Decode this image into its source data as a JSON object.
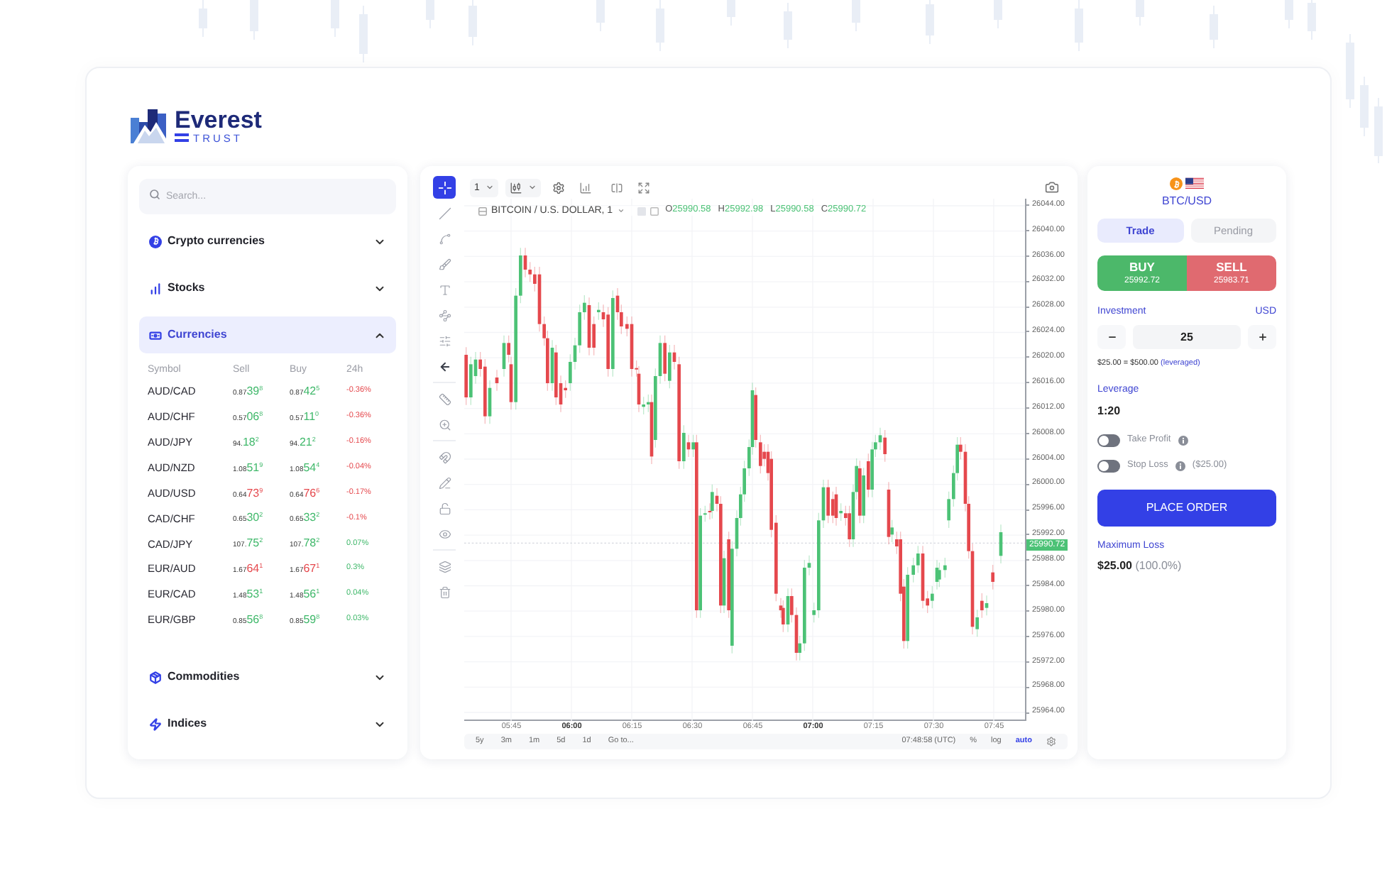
{
  "brand": {
    "name": "Everest",
    "tagline": "TRUST"
  },
  "sidebar": {
    "search_placeholder": "Search...",
    "sections": [
      {
        "kind": "crypto",
        "title": "Crypto currencies",
        "expanded": false
      },
      {
        "kind": "stocks",
        "title": "Stocks",
        "expanded": false
      },
      {
        "kind": "currencies",
        "title": "Currencies",
        "expanded": true,
        "table": {
          "columns": [
            "Symbol",
            "Sell",
            "Buy",
            "24h"
          ],
          "rows": [
            {
              "symbol": "AUD/CAD",
              "sell": {
                "lead": "0.87",
                "pips": "39",
                "last": "8",
                "up": true
              },
              "buy": {
                "lead": "0.87",
                "pips": "42",
                "last": "5",
                "up": true
              },
              "change": {
                "text": "-0.36%",
                "up": false
              }
            },
            {
              "symbol": "AUD/CHF",
              "sell": {
                "lead": "0.57",
                "pips": "06",
                "last": "8",
                "up": true
              },
              "buy": {
                "lead": "0.57",
                "pips": "11",
                "last": "0",
                "up": true
              },
              "change": {
                "text": "-0.36%",
                "up": false
              }
            },
            {
              "symbol": "AUD/JPY",
              "sell": {
                "lead": "94.",
                "pips": "18",
                "last": "2",
                "up": true
              },
              "buy": {
                "lead": "94.",
                "pips": "21",
                "last": "2",
                "up": true
              },
              "change": {
                "text": "-0.16%",
                "up": false
              }
            },
            {
              "symbol": "AUD/NZD",
              "sell": {
                "lead": "1.08",
                "pips": "51",
                "last": "9",
                "up": true
              },
              "buy": {
                "lead": "1.08",
                "pips": "54",
                "last": "4",
                "up": true
              },
              "change": {
                "text": "-0.04%",
                "up": false
              }
            },
            {
              "symbol": "AUD/USD",
              "sell": {
                "lead": "0.64",
                "pips": "73",
                "last": "9",
                "up": false
              },
              "buy": {
                "lead": "0.64",
                "pips": "76",
                "last": "6",
                "up": false
              },
              "change": {
                "text": "-0.17%",
                "up": false
              }
            },
            {
              "symbol": "CAD/CHF",
              "sell": {
                "lead": "0.65",
                "pips": "30",
                "last": "2",
                "up": true
              },
              "buy": {
                "lead": "0.65",
                "pips": "33",
                "last": "2",
                "up": true
              },
              "change": {
                "text": "-0.1%",
                "up": false
              }
            },
            {
              "symbol": "CAD/JPY",
              "sell": {
                "lead": "107.",
                "pips": "75",
                "last": "2",
                "up": true
              },
              "buy": {
                "lead": "107.",
                "pips": "78",
                "last": "2",
                "up": true
              },
              "change": {
                "text": "0.07%",
                "up": true
              }
            },
            {
              "symbol": "EUR/AUD",
              "sell": {
                "lead": "1.67",
                "pips": "64",
                "last": "1",
                "up": false
              },
              "buy": {
                "lead": "1.67",
                "pips": "67",
                "last": "1",
                "up": false
              },
              "change": {
                "text": "0.3%",
                "up": true
              }
            },
            {
              "symbol": "EUR/CAD",
              "sell": {
                "lead": "1.48",
                "pips": "53",
                "last": "1",
                "up": true
              },
              "buy": {
                "lead": "1.48",
                "pips": "56",
                "last": "1",
                "up": true
              },
              "change": {
                "text": "0.04%",
                "up": true
              }
            },
            {
              "symbol": "EUR/GBP",
              "sell": {
                "lead": "0.85",
                "pips": "56",
                "last": "8",
                "up": true
              },
              "buy": {
                "lead": "0.85",
                "pips": "59",
                "last": "8",
                "up": true
              },
              "change": {
                "text": "0.03%",
                "up": true
              }
            }
          ]
        }
      },
      {
        "kind": "commodities",
        "title": "Commodities",
        "expanded": false
      },
      {
        "kind": "indices",
        "title": "Indices",
        "expanded": false
      }
    ]
  },
  "chart": {
    "tool_groups": [
      [
        {
          "kind": "crosshair",
          "selected": true
        },
        {
          "kind": "line",
          "selected": false
        },
        {
          "kind": "fib",
          "selected": false
        },
        {
          "kind": "brush",
          "selected": false
        },
        {
          "kind": "text",
          "selected": false
        },
        {
          "kind": "pattern",
          "selected": false
        },
        {
          "kind": "forecast",
          "selected": false
        },
        {
          "kind": "back",
          "selected": false
        }
      ],
      [
        {
          "kind": "measure",
          "selected": false
        },
        {
          "kind": "zoom",
          "selected": false
        }
      ],
      [
        {
          "kind": "magnet",
          "selected": false
        },
        {
          "kind": "draw_lock",
          "selected": false
        },
        {
          "kind": "lock",
          "selected": false
        },
        {
          "kind": "visibility",
          "selected": false
        }
      ],
      [
        {
          "kind": "layers",
          "selected": false
        },
        {
          "kind": "trash",
          "selected": false
        }
      ]
    ],
    "interval": "1",
    "legend": {
      "title": "BITCOIN / U.S. DOLLAR, 1",
      "values": [
        {
          "label": "O",
          "value": "25990.58"
        },
        {
          "label": "H",
          "value": "25992.98"
        },
        {
          "label": "L",
          "value": "25990.58"
        },
        {
          "label": "C",
          "value": "25990.72"
        }
      ]
    },
    "price_axis": [
      "26044.00",
      "26040.00",
      "26036.00",
      "26032.00",
      "26028.00",
      "26024.00",
      "26020.00",
      "26016.00",
      "26012.00",
      "26008.00",
      "26004.00",
      "26000.00",
      "25996.00",
      "25992.00",
      "25988.00",
      "25984.00",
      "25980.00",
      "25976.00",
      "25972.00",
      "25968.00",
      "25964.00"
    ],
    "current_price": "25990.72",
    "time_axis": [
      {
        "label": "05:45",
        "major": false
      },
      {
        "label": "06:00",
        "major": true
      },
      {
        "label": "06:15",
        "major": false
      },
      {
        "label": "06:30",
        "major": false
      },
      {
        "label": "06:45",
        "major": false
      },
      {
        "label": "07:00",
        "major": true
      },
      {
        "label": "07:15",
        "major": false
      },
      {
        "label": "07:30",
        "major": false
      },
      {
        "label": "07:45",
        "major": false
      }
    ],
    "ranges": [
      "5y",
      "3m",
      "1m",
      "5d",
      "1d"
    ],
    "goto": "Go to...",
    "clock": "07:48:58 (UTC)",
    "scale_options": [
      {
        "label": "%",
        "selected": false
      },
      {
        "label": "log",
        "selected": false
      },
      {
        "label": "auto",
        "selected": true
      }
    ]
  },
  "order_panel": {
    "pair": "BTC/USD",
    "tabs": [
      {
        "label": "Trade",
        "selected": true
      },
      {
        "label": "Pending",
        "selected": false
      }
    ],
    "sides": [
      {
        "kind": "buy",
        "label": "BUY",
        "price": "25992.72",
        "selected": true
      },
      {
        "kind": "sell",
        "label": "SELL",
        "price": "25983.71",
        "selected": false
      }
    ],
    "investment": {
      "label": "Investment",
      "currency": "USD",
      "value": "25"
    },
    "leverage_note": {
      "text": "$25.00 = $500.00",
      "suffix": "(leveraged)"
    },
    "leverage": {
      "label": "Leverage",
      "value": "1:20"
    },
    "toggles": [
      {
        "label": "Take Profit",
        "on": false
      },
      {
        "label": "Stop Loss",
        "on": false,
        "note": "($25.00)"
      }
    ],
    "submit": "PLACE ORDER",
    "max_loss": {
      "label": "Maximum Loss",
      "value": "$25.00",
      "percent": "(100.0%)"
    }
  }
}
